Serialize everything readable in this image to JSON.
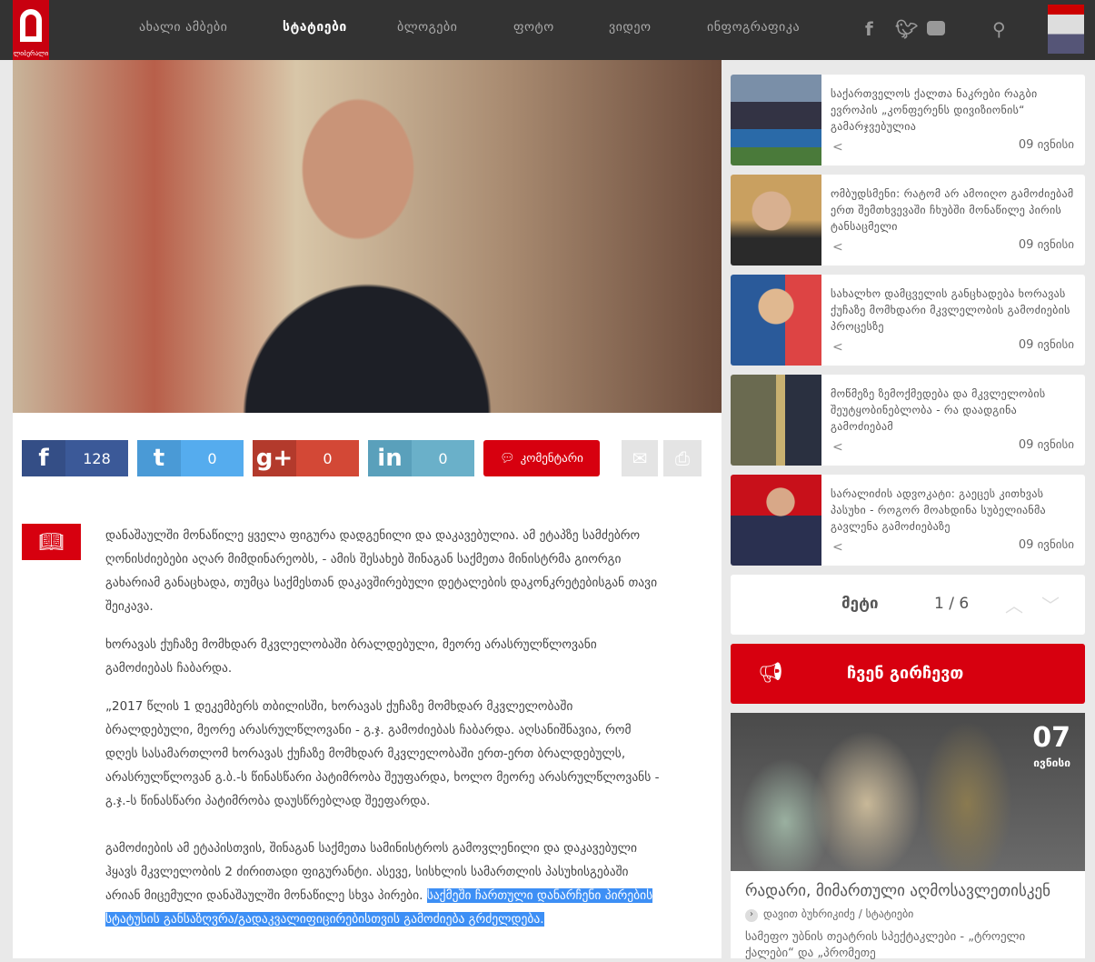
{
  "header": {
    "logo_text": "ლიბერალი",
    "nav": [
      "ახალი ამბები",
      "სტატიები",
      "ბლოგები",
      "ფოტო",
      "ვიდეო",
      "ინფოგრაფიკა"
    ],
    "active_nav": "სტატიები"
  },
  "share": {
    "facebook": "128",
    "twitter": "0",
    "googleplus": "0",
    "linkedin": "0",
    "comment_label": "კომენტარი"
  },
  "article": {
    "paragraphs": [
      "დანაშაულში მონაწილე ყველა ფიგურა დადგენილი და დაკავებულია. ამ ეტაპზე სამძებრო ღონისძიებები აღარ მიმდინარეობს, - ამის შესახებ შინაგან საქმეთა მინისტრმა გიორგი გახარიამ განაცხადა, თუმცა საქმესთან დაკავშირებული დეტალების დაკონკრეტებისგან თავი შეიკავა.",
      "ხორავას ქუჩაზე მომხდარ მკვლელობაში ბრალდებული, მეორე არასრულწლოვანი გამოძიებას ჩაბარდა.",
      "„2017 წლის 1 დეკემბერს თბილისში, ხორავას ქუჩაზე მომხდარ მკვლელობაში ბრალდებული, მეორე არასრულწლოვანი - გ.ჯ. გამოძიებას ჩაბარდა. აღსანიშნავია, რომ დღეს სასამართლომ ხორავას ქუჩაზე მომხდარ მკვლელობაში ერთ-ერთ ბრალდებულს, არასრულწლოვან გ.ბ.-ს წინასწარი პატიმრობა შეუფარდა, ხოლო მეორე არასრულწლოვანს - გ.ჯ.-ს წინასწარი პატიმრობა დაუსწრებლად შეეფარდა.",
      "გამოძიების ამ ეტაპისთვის, შინაგან საქმეთა სამინისტროს გამოვლენილი და დაკავებული ჰყავს მკვლელობის 2 ძირითადი ფიგურანტი. ასევე, სისხლის სამართლის პასუხისგებაში არიან მიცემული დანაშაულში მონაწილე სხვა პირები."
    ],
    "selected_text": "საქმეში ჩართული დანარჩენი პირების სტატუსის განსაზღვრა/გადაკვალიფიცირებისთვის გამოძიება გრძელდება."
  },
  "sidebar": {
    "items": [
      {
        "title": "საქართველოს ქალთა ნაკრები რაგბი ევროპის „კონფერენს დივიზიონის“ გამარჯვებულია",
        "date": "09 ივნისი"
      },
      {
        "title": "ომბუდსმენი: რატომ არ ამოიღო გამოძიებამ ერთ შემთხვევაში ჩხუბში მონაწილე პირის ტანსაცმელი",
        "date": "09 ივნისი"
      },
      {
        "title": "სახალხო დამცველის განცხადება ხორავას ქუჩაზე მომხდარი მკვლელობის გამოძიების პროცესზე",
        "date": "09 ივნისი"
      },
      {
        "title": "მოწმეზე ზემოქმედება და მკვლელობის შეუტყობინებლობა - რა დაადგინა გამოძიებამ",
        "date": "09 ივნისი"
      },
      {
        "title": "სარალიძის ადვოკატი: გაეცეს კითხვას პასუხი - როგორ მოახდინა სუბელიანმა გავლენა გამოძიებაზე",
        "date": "09 ივნისი"
      }
    ],
    "more_label": "მეტი",
    "pagination": "1 / 6"
  },
  "recommend": {
    "label": "ჩვენ გირჩევთ",
    "day": "07",
    "month": "ივნისი",
    "title": "რადარი, მიმართული აღმოსავლეთისკენ",
    "meta": "დავით ბუხრიკიძე / სტატიები",
    "excerpt": "სამეფო უბნის თეატრის სპექტაკლები - „ტროელი ქალები“ და „პრომეთე"
  }
}
